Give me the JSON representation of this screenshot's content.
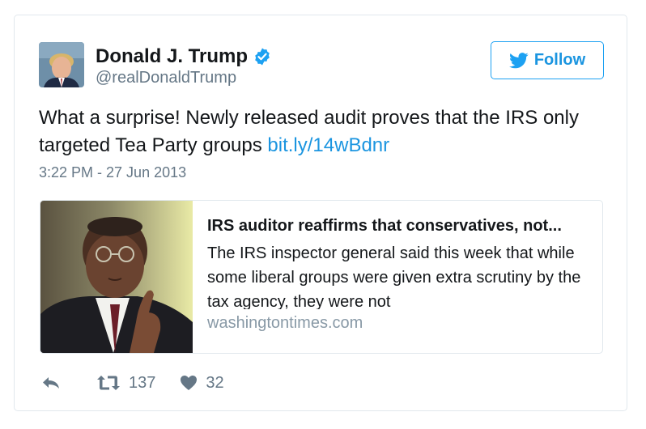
{
  "tweet": {
    "display_name": "Donald J. Trump",
    "handle": "@realDonaldTrump",
    "verified": true,
    "follow_label": "Follow",
    "text": "What a surprise! Newly released audit proves that the IRS only targeted Tea Party groups ",
    "link_text": "bit.ly/14wBdnr",
    "timestamp": "3:22 PM - 27 Jun 2013",
    "colors": {
      "accent": "#1da1f2",
      "link": "#1b95e0",
      "secondary_text": "#657786",
      "border": "#e1e8ed"
    }
  },
  "card": {
    "title": "IRS auditor reaffirms that conservatives, not...",
    "description": "The IRS inspector general said this week that while some liberal groups were given extra scrutiny by the tax agency, they were not",
    "domain": "washingtontimes.com"
  },
  "actions": {
    "reply_icon": "reply-icon",
    "retweet_icon": "retweet-icon",
    "retweet_count": "137",
    "like_icon": "heart-icon",
    "like_count": "32"
  }
}
